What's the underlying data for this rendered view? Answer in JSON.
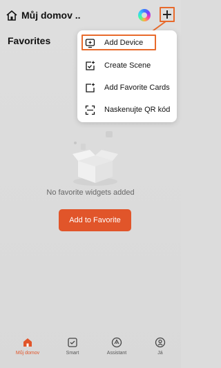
{
  "header": {
    "home_title": "Můj domov ..",
    "favorites_title": "Favorites"
  },
  "menu": {
    "items": [
      {
        "label": "Add Device",
        "icon": "add-device-icon"
      },
      {
        "label": "Create Scene",
        "icon": "create-scene-icon"
      },
      {
        "label": "Add Favorite Cards",
        "icon": "add-card-icon"
      },
      {
        "label": "Naskenujte QR kód",
        "icon": "scan-qr-icon"
      }
    ]
  },
  "empty_state": {
    "message": "No favorite widgets added",
    "button_label": "Add to Favorite"
  },
  "tabs": [
    {
      "label": "Můj domov",
      "icon": "home-tab-icon",
      "active": true
    },
    {
      "label": "Smart",
      "icon": "smart-tab-icon",
      "active": false
    },
    {
      "label": "Assistant",
      "icon": "assistant-tab-icon",
      "active": false
    },
    {
      "label": "Já",
      "icon": "profile-tab-icon",
      "active": false
    }
  ],
  "colors": {
    "accent": "#e1552a",
    "highlight_outline": "#e86a2b",
    "background": "#dcdcdc"
  }
}
